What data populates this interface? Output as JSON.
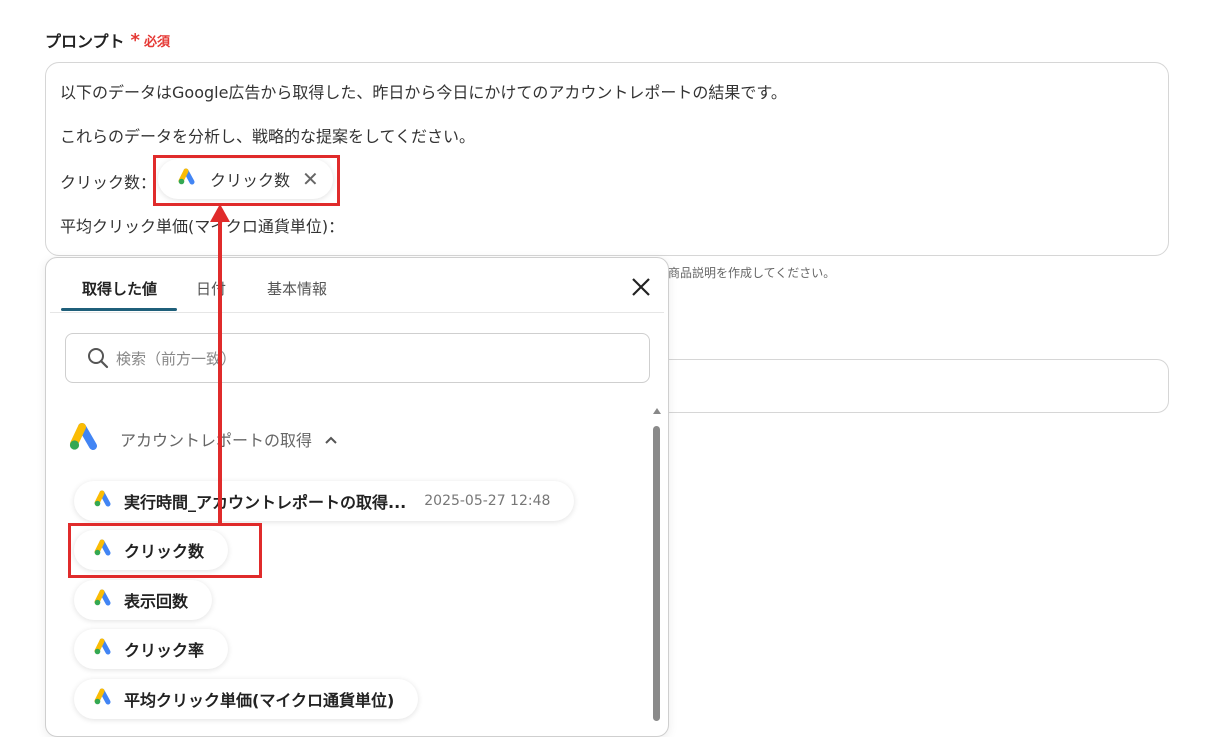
{
  "field": {
    "label": "プロンプト",
    "asterisk": "*",
    "required": "必須"
  },
  "prompt": {
    "lines": [
      "以下のデータはGoogle広告から取得した、昨日から今日にかけてのアカウントレポートの結果です。",
      "これらのデータを分析し、戦略的な提案をしてください。",
      "クリック数：",
      "平均クリック単価(マイクロ通貨単位)："
    ],
    "chip_label": "クリック数",
    "chip_close": "✕"
  },
  "hint": "商品説明を作成してください。",
  "panel": {
    "tabs": [
      "取得した値",
      "日付",
      "基本情報"
    ],
    "active_tab": 0,
    "search_placeholder": "検索（前方一致）",
    "section_title": "アカウントレポートの取得",
    "items": [
      {
        "label": "実行時間_アカウントレポートの取得...",
        "value": "2025-05-27 12:48"
      },
      {
        "label": "クリック数"
      },
      {
        "label": "表示回数"
      },
      {
        "label": "クリック率"
      },
      {
        "label": "平均クリック単価(マイクロ通貨単位)"
      }
    ]
  },
  "colors": {
    "accent": "#1f5f7a",
    "required": "#e53935",
    "annotation": "#e02b2b",
    "gads_blue": "#4285F4",
    "gads_yellow": "#FBBC04",
    "gads_green": "#34A853"
  },
  "icons": {
    "source": "google-ads-icon",
    "close": "close-icon",
    "search": "search-icon",
    "collapse": "chevron-up-icon"
  }
}
